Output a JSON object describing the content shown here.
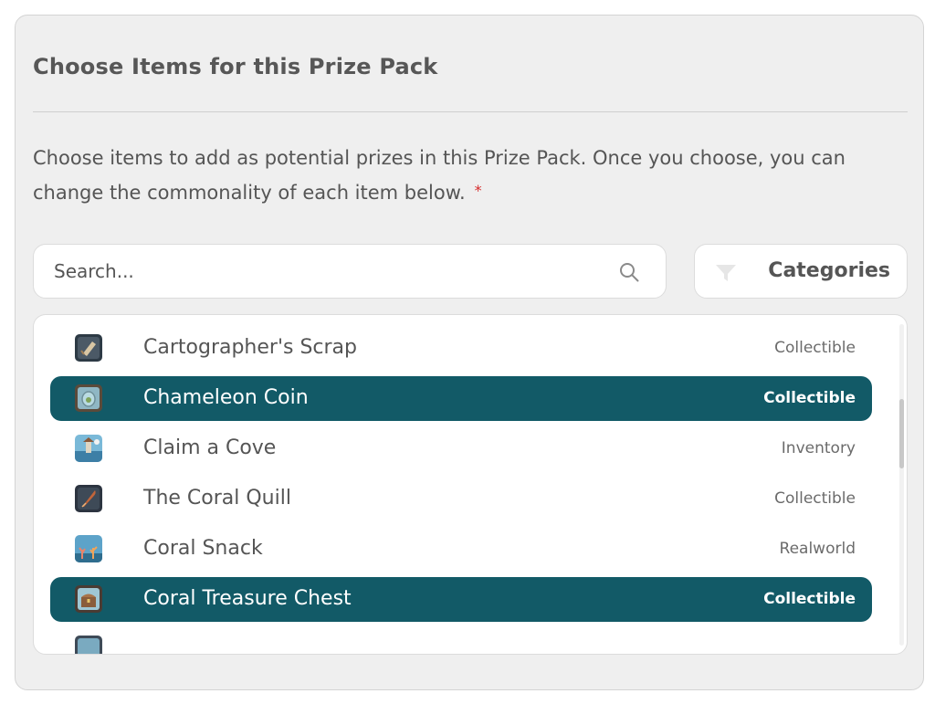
{
  "panel": {
    "title": "Choose Items for this Prize Pack",
    "description": "Choose items to add as potential prizes in this Prize Pack. Once you choose, you can change the commonality of each item below.",
    "required_marker": "*"
  },
  "search": {
    "placeholder": "Search...",
    "value": ""
  },
  "filter": {
    "label": "Categories"
  },
  "items": [
    {
      "name": "Cartographer's Scrap",
      "category": "Collectible",
      "selected": false
    },
    {
      "name": "Chameleon Coin",
      "category": "Collectible",
      "selected": true
    },
    {
      "name": "Claim a Cove",
      "category": "Inventory",
      "selected": false
    },
    {
      "name": "The Coral Quill",
      "category": "Collectible",
      "selected": false
    },
    {
      "name": "Coral Snack",
      "category": "Realworld",
      "selected": false
    },
    {
      "name": "Coral Treasure Chest",
      "category": "Collectible",
      "selected": true
    }
  ],
  "colors": {
    "selected_row": "#125a67",
    "required_star": "#d62b2b",
    "panel_bg": "#efefef"
  }
}
